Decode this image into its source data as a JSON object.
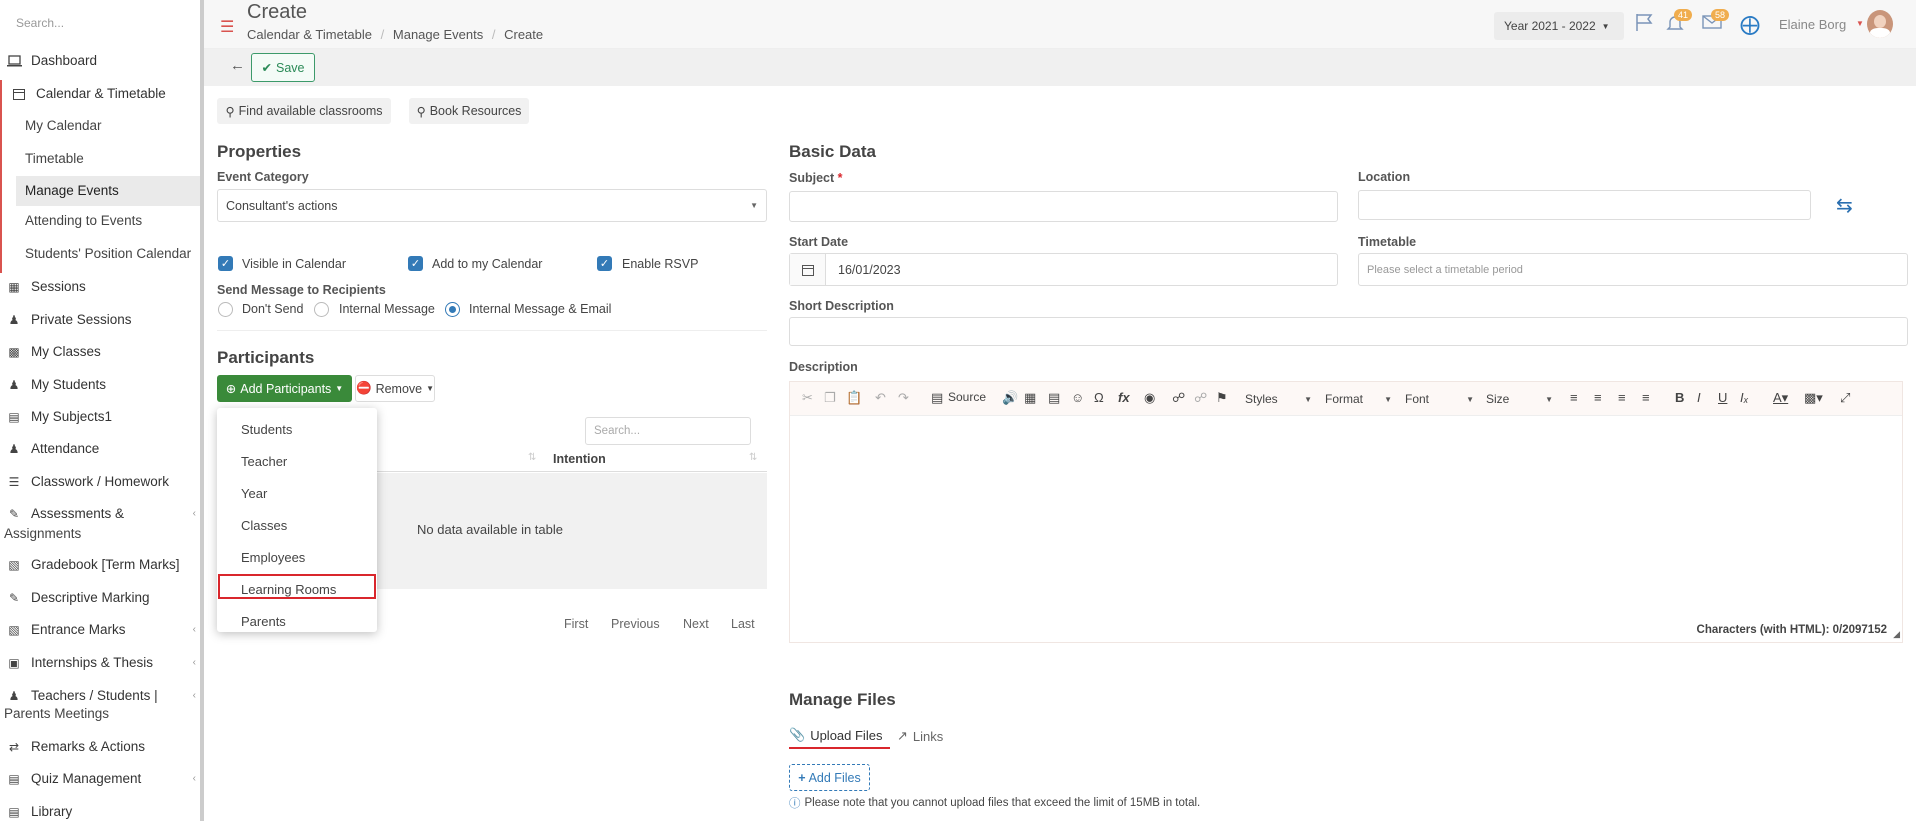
{
  "sidebar": {
    "search_placeholder": "Search...",
    "items": [
      {
        "label": "Dashboard",
        "icon": "laptop-icon"
      },
      {
        "label": "Calendar & Timetable",
        "icon": "calendar-icon"
      },
      {
        "label": "My Calendar"
      },
      {
        "label": "Timetable"
      },
      {
        "label": "Manage Events"
      },
      {
        "label": "Attending to Events"
      },
      {
        "label": "Students' Position Calendar"
      },
      {
        "label": "Sessions",
        "icon": "sessions-icon"
      },
      {
        "label": "Private Sessions",
        "icon": "private-sessions-icon"
      },
      {
        "label": "My Classes",
        "icon": "classes-icon"
      },
      {
        "label": "My Students",
        "icon": "students-icon"
      },
      {
        "label": "My Subjects1",
        "icon": "subjects-icon"
      },
      {
        "label": "Attendance",
        "icon": "attendance-icon"
      },
      {
        "label": "Classwork / Homework",
        "icon": "list-icon"
      },
      {
        "label": "Assessments &",
        "label2": "Assignments",
        "icon": "edit-icon"
      },
      {
        "label": "Gradebook [Term Marks]",
        "icon": "gradebook-icon"
      },
      {
        "label": "Descriptive Marking",
        "icon": "descriptive-icon"
      },
      {
        "label": "Entrance Marks",
        "icon": "entrance-icon"
      },
      {
        "label": "Internships & Thesis",
        "icon": "internship-icon"
      },
      {
        "label": "Teachers / Students |",
        "label2": "Parents Meetings",
        "icon": "meetings-icon"
      },
      {
        "label": "Remarks & Actions",
        "icon": "remarks-icon"
      },
      {
        "label": "Quiz Management",
        "icon": "quiz-icon"
      },
      {
        "label": "Library",
        "icon": "library-icon"
      }
    ]
  },
  "header": {
    "title": "Create",
    "breadcrumb": [
      "Calendar & Timetable",
      "Manage Events",
      "Create"
    ],
    "year": "Year 2021 - 2022",
    "notif_count": "41",
    "msg_count": "58",
    "user": "Elaine Borg"
  },
  "toolbar": {
    "save_label": "Save"
  },
  "actions": {
    "find_classrooms": "Find available classrooms",
    "book_resources": "Book Resources"
  },
  "properties": {
    "title": "Properties",
    "category_label": "Event Category",
    "category_value": "Consultant's actions",
    "checkboxes": [
      "Visible in Calendar",
      "Add to my Calendar",
      "Enable RSVP"
    ],
    "send_label": "Send Message to Recipients",
    "radios": [
      "Don't Send",
      "Internal Message",
      "Internal Message & Email"
    ]
  },
  "participants": {
    "title": "Participants",
    "add_label": "Add Participants",
    "remove_label": "Remove",
    "search_placeholder": "Search...",
    "col_intention": "Intention",
    "empty": "No data available in table",
    "pager": [
      "First",
      "Previous",
      "Next",
      "Last"
    ],
    "menu": [
      "Students",
      "Teacher",
      "Year",
      "Classes",
      "Employees",
      "Learning Rooms",
      "Parents"
    ]
  },
  "basic": {
    "title": "Basic Data",
    "subject_label": "Subject",
    "required_mark": "*",
    "location_label": "Location",
    "start_label": "Start Date",
    "start_value": "16/01/2023",
    "timetable_label": "Timetable",
    "timetable_placeholder": "Please select a timetable period",
    "short_desc_label": "Short Description",
    "desc_label": "Description",
    "editor": {
      "source": "Source",
      "styles": "Styles",
      "format": "Format",
      "font": "Font",
      "size": "Size",
      "char_count": "Characters (with HTML): 0/2097152"
    }
  },
  "files": {
    "title": "Manage Files",
    "tab_upload": "Upload Files",
    "tab_links": "Links",
    "add_files": "Add Files",
    "note": "Please note that you cannot upload files that exceed the limit of 15MB in total."
  },
  "colors": {
    "accent": "#337ab7",
    "danger": "#d9534f",
    "success": "#3a8a3a"
  }
}
